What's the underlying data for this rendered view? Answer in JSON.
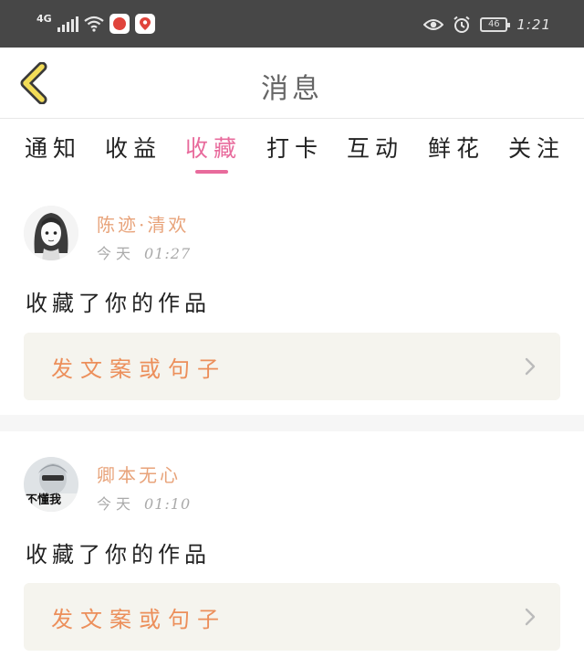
{
  "status_bar": {
    "network": "4G",
    "battery": "46",
    "time": "1:21"
  },
  "header": {
    "title": "消息"
  },
  "tabs": [
    {
      "label": "通知"
    },
    {
      "label": "收益"
    },
    {
      "label": "收藏",
      "active": true
    },
    {
      "label": "打卡"
    },
    {
      "label": "互动"
    },
    {
      "label": "鲜花"
    },
    {
      "label": "关注"
    }
  ],
  "messages": [
    {
      "user": "陈迹·清欢",
      "day": "今天",
      "time": "01:27",
      "action": "收藏了你的作品",
      "work_title": "发文案或句子",
      "avatar_caption": ""
    },
    {
      "user": "卿本无心",
      "day": "今天",
      "time": "01:10",
      "action": "收藏了你的作品",
      "work_title": "发文案或句子",
      "avatar_caption": "不懂我"
    }
  ],
  "colors": {
    "accent": "#e86b9c",
    "username": "#e8a37a",
    "work_title": "#ec8f5b",
    "status_bar": "#474747",
    "back_arrow": "#f2dc58"
  }
}
